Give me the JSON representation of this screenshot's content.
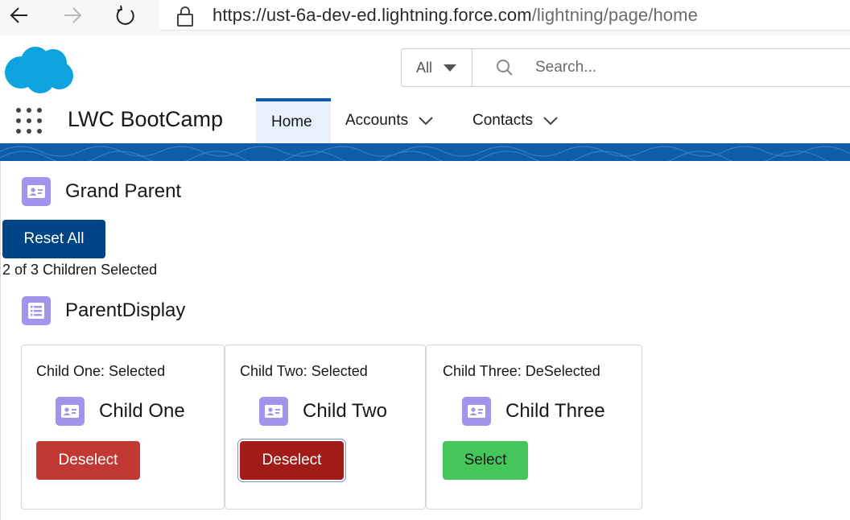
{
  "browser": {
    "url_host": "https://ust-6a-dev-ed.lightning.force.com",
    "url_path": "/lightning/page/home"
  },
  "header": {
    "search_scope": "All",
    "search_placeholder": "Search..."
  },
  "app": {
    "name": "LWC BootCamp",
    "tabs": [
      {
        "label": "Home",
        "active": true
      },
      {
        "label": "Accounts",
        "active": false
      },
      {
        "label": "Contacts",
        "active": false
      }
    ]
  },
  "grand_parent": {
    "title": "Grand Parent",
    "reset_label": "Reset All",
    "selection_summary": "2 of 3 Children Selected"
  },
  "parent": {
    "title": "ParentDisplay",
    "children": [
      {
        "status": "Child One: Selected",
        "name": "Child One",
        "button": "Deselect"
      },
      {
        "status": "Child Two: Selected",
        "name": "Child Two",
        "button": "Deselect"
      },
      {
        "status": "Child Three: DeSelected",
        "name": "Child Three",
        "button": "Select"
      }
    ]
  },
  "colors": {
    "brand_blue": "#0f5da8",
    "reset_button": "#014486",
    "deselect_button": "#c23934",
    "select_button": "#45c65a",
    "card_icon": "#a094ed"
  }
}
